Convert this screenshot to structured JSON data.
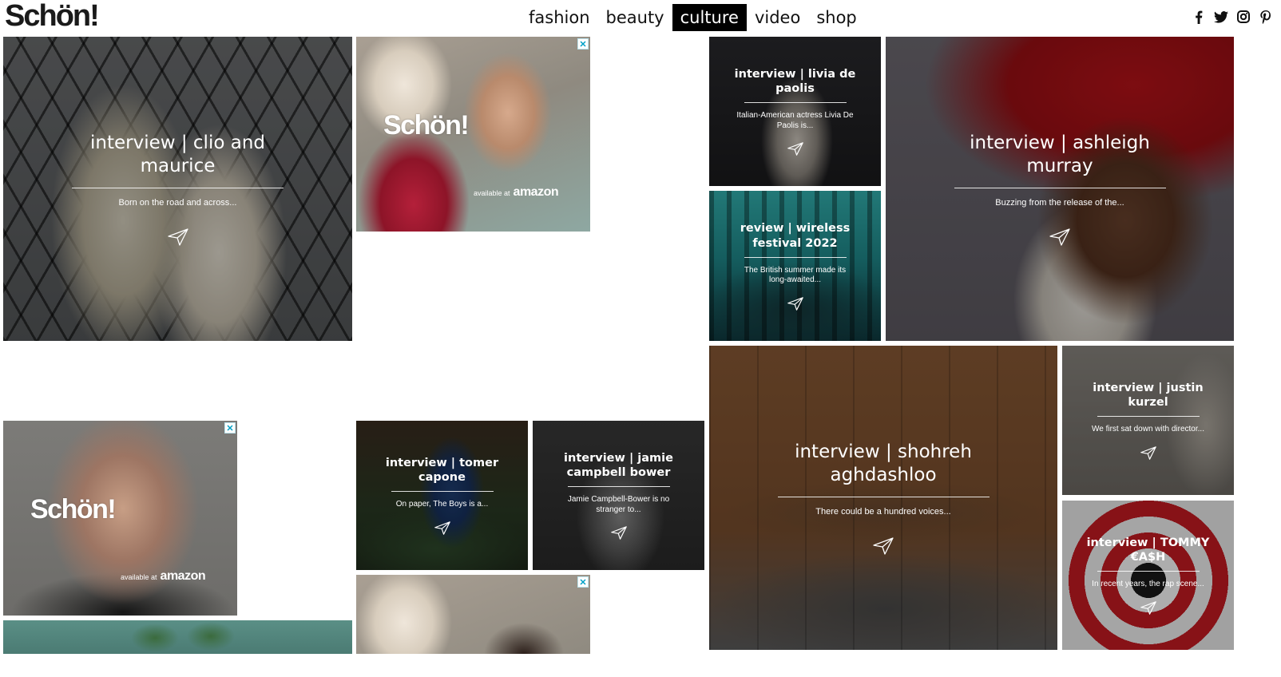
{
  "site": {
    "logo": "Schön!"
  },
  "nav": {
    "items": [
      {
        "label": "fashion",
        "active": false
      },
      {
        "label": "beauty",
        "active": false
      },
      {
        "label": "culture",
        "active": true
      },
      {
        "label": "video",
        "active": false
      },
      {
        "label": "shop",
        "active": false
      }
    ]
  },
  "social": [
    "facebook-icon",
    "twitter-icon",
    "instagram-icon",
    "pinterest-icon"
  ],
  "articles": {
    "clio": {
      "title": "interview | clio and maurice",
      "excerpt": "Born on the road and across..."
    },
    "livia": {
      "title": "interview | livia de paolis",
      "excerpt": "Italian-American actress Livia De Paolis is..."
    },
    "wireless": {
      "title": "review | wireless festival 2022",
      "excerpt": "The British summer made its long-awaited..."
    },
    "ashleigh": {
      "title": "interview | ashleigh murray",
      "excerpt": "Buzzing from the release of the..."
    },
    "tomer": {
      "title": "interview | tomer capone",
      "excerpt": "On paper, The Boys is a..."
    },
    "jamie": {
      "title": "interview | jamie campbell bower",
      "excerpt": "Jamie Campbell-Bower is no stranger to..."
    },
    "shohreh": {
      "title": "interview | shohreh aghdashloo",
      "excerpt": "There could be a hundred voices..."
    },
    "justin": {
      "title": "interview | justin kurzel",
      "excerpt": "We first sat down with director..."
    },
    "tommy": {
      "title": "interview | TOMMY €A$H",
      "excerpt": "In recent years, the rap scene..."
    }
  },
  "ads": {
    "logo": "Schön!",
    "available": "available at",
    "amazon": "amazon"
  }
}
